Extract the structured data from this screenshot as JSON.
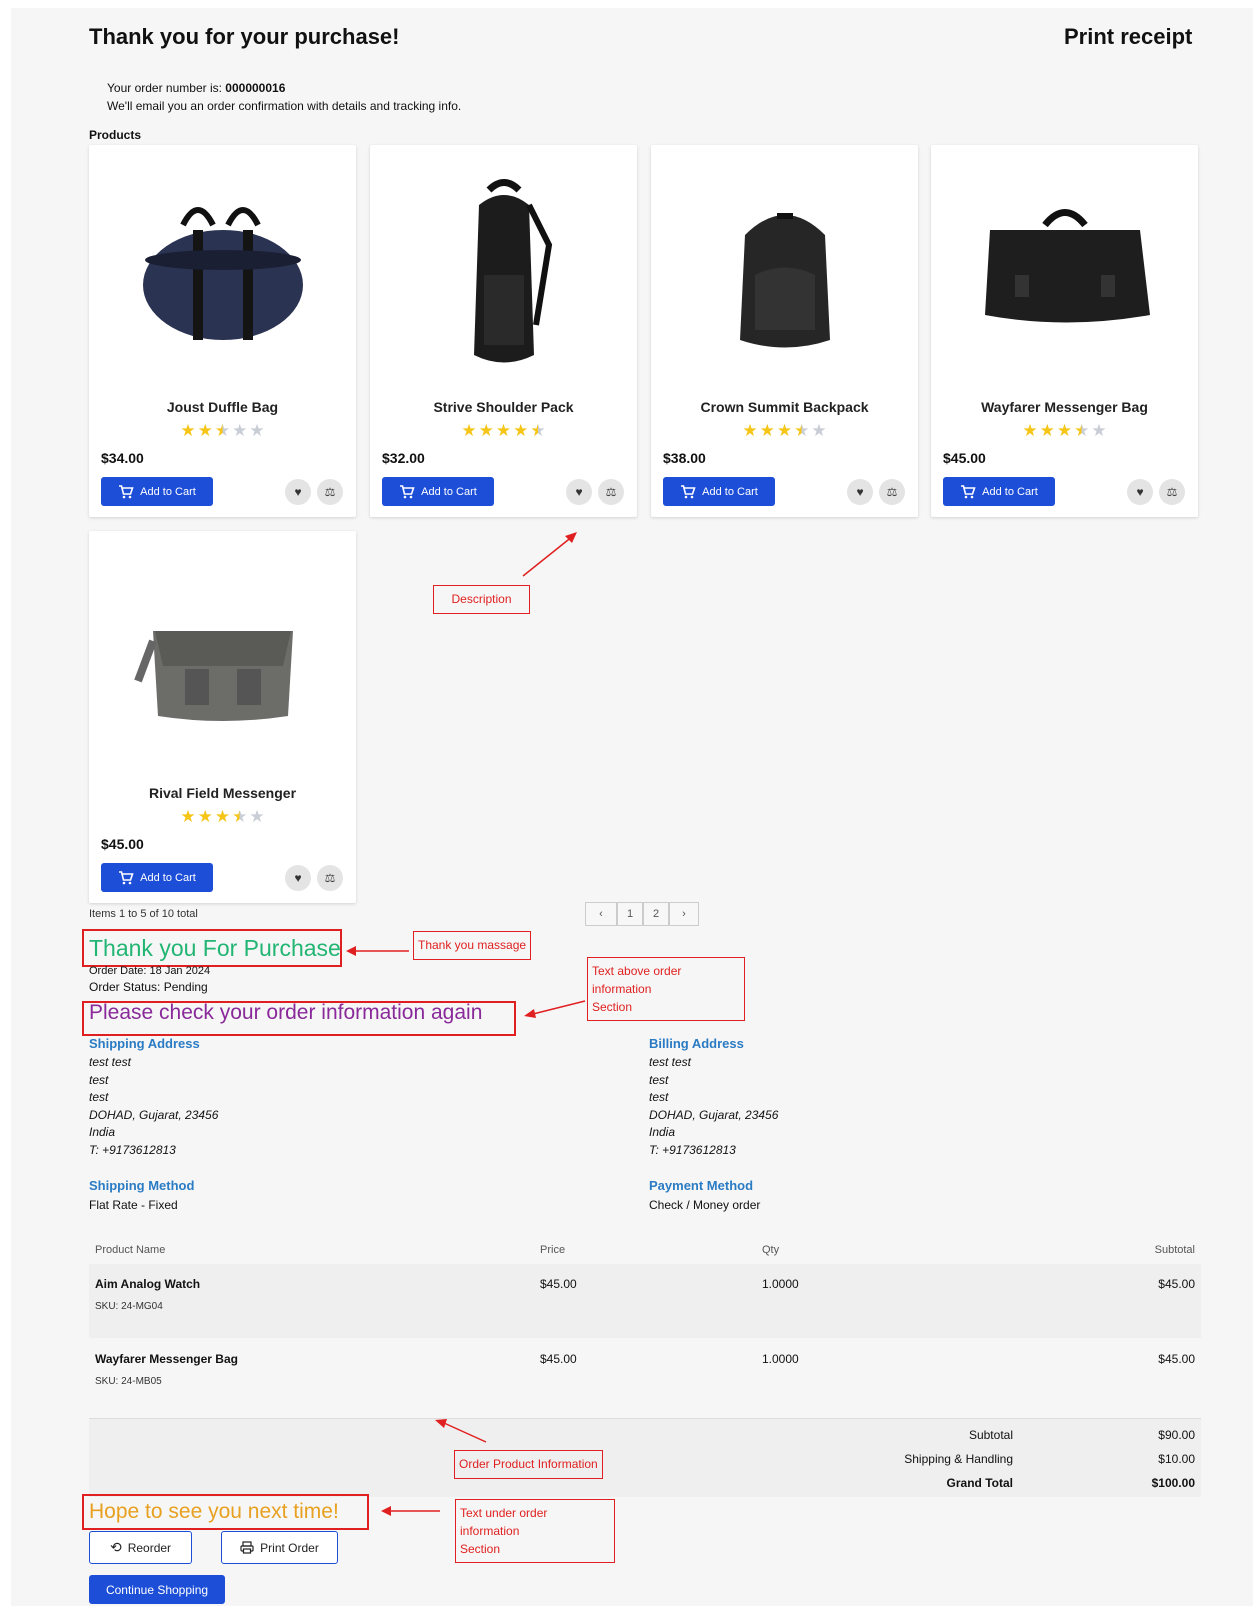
{
  "header": {
    "title": "Thank you for your purchase!",
    "print_receipt": "Print receipt",
    "order_number_prefix": "Your order number is:",
    "order_number": "000000016",
    "email_note": "We'll email you an order confirmation with details and tracking info.",
    "products_label": "Products"
  },
  "products": [
    {
      "name": "Joust Duffle Bag",
      "price": "$34.00",
      "rating": 2.5,
      "cart_label": "Add to Cart"
    },
    {
      "name": "Strive Shoulder Pack",
      "price": "$32.00",
      "rating": 4.5,
      "cart_label": "Add to Cart"
    },
    {
      "name": "Crown Summit Backpack",
      "price": "$38.00",
      "rating": 3.5,
      "cart_label": "Add to Cart"
    },
    {
      "name": "Wayfarer Messenger Bag",
      "price": "$45.00",
      "rating": 3.5,
      "cart_label": "Add to Cart"
    },
    {
      "name": "Rival Field Messenger",
      "price": "$45.00",
      "rating": 3.5,
      "cart_label": "Add to Cart"
    }
  ],
  "pagination": {
    "items_total": "Items 1 to 5 of 10 total",
    "pages": [
      "1",
      "2"
    ]
  },
  "annotations": {
    "description": "Description",
    "thank_you_massage": "Thank you massage",
    "text_above_line1": "Text above order information",
    "text_above_line2": "Section",
    "order_product_info": "Order Product Information",
    "text_under_line1": "Text under order information",
    "text_under_line2": "Section"
  },
  "order": {
    "thank_you": "Thank you For Purchase",
    "order_date": "Order Date: 18 Jan 2024",
    "order_status": "Order Status: Pending",
    "please_check": "Please check your order information again",
    "shipping_address_title": "Shipping Address",
    "shipping_address": [
      "test test",
      "test",
      "test",
      "DOHAD, Gujarat, 23456",
      "India",
      "T: +9173612813"
    ],
    "billing_address_title": "Billing Address",
    "billing_address": [
      "test test",
      "test",
      "test",
      "DOHAD, Gujarat, 23456",
      "India",
      "T: +9173612813"
    ],
    "shipping_method_title": "Shipping Method",
    "shipping_method": "Flat Rate - Fixed",
    "payment_method_title": "Payment Method",
    "payment_method": "Check / Money order"
  },
  "table": {
    "headers": {
      "name": "Product Name",
      "price": "Price",
      "qty": "Qty",
      "subtotal": "Subtotal"
    },
    "rows": [
      {
        "name": "Aim Analog Watch",
        "sku": "SKU: 24-MG04",
        "price": "$45.00",
        "qty": "1.0000",
        "subtotal": "$45.00"
      },
      {
        "name": "Wayfarer Messenger Bag",
        "sku": "SKU: 24-MB05",
        "price": "$45.00",
        "qty": "1.0000",
        "subtotal": "$45.00"
      }
    ],
    "totals": {
      "subtotal_label": "Subtotal",
      "subtotal": "$90.00",
      "shipping_label": "Shipping & Handling",
      "shipping": "$10.00",
      "grand_label": "Grand Total",
      "grand": "$100.00"
    }
  },
  "footer": {
    "hope": "Hope to see you next time!",
    "reorder": "Reorder",
    "print_order": "Print Order",
    "continue_shopping": "Continue Shopping"
  },
  "colors": {
    "primary": "#1d4ed8",
    "annotation": "#e02020",
    "thank_you_text": "#22b573",
    "please_check_text": "#8a2a9a",
    "hope_text": "#e8a020",
    "section_heading": "#2a7bc4",
    "star": "#f5c518"
  }
}
